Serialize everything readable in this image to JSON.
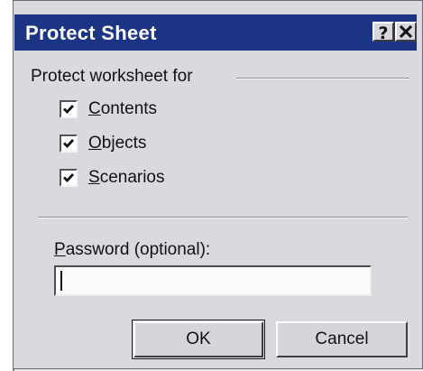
{
  "dialog": {
    "title": "Protect Sheet",
    "help_glyph": "?",
    "close_glyph": "✕"
  },
  "protect": {
    "group_label": "Protect worksheet for",
    "options": [
      {
        "accel": "C",
        "rest": "ontents",
        "checked": true
      },
      {
        "accel": "O",
        "rest": "bjects",
        "checked": true
      },
      {
        "accel": "S",
        "rest": "cenarios",
        "checked": true
      }
    ]
  },
  "password": {
    "label_accel": "P",
    "label_rest": "assword (optional):",
    "value": ""
  },
  "buttons": {
    "ok_label": "OK",
    "cancel_label": "Cancel"
  },
  "colors": {
    "titlebar": "#1b3584",
    "face": "#dcd9de"
  }
}
